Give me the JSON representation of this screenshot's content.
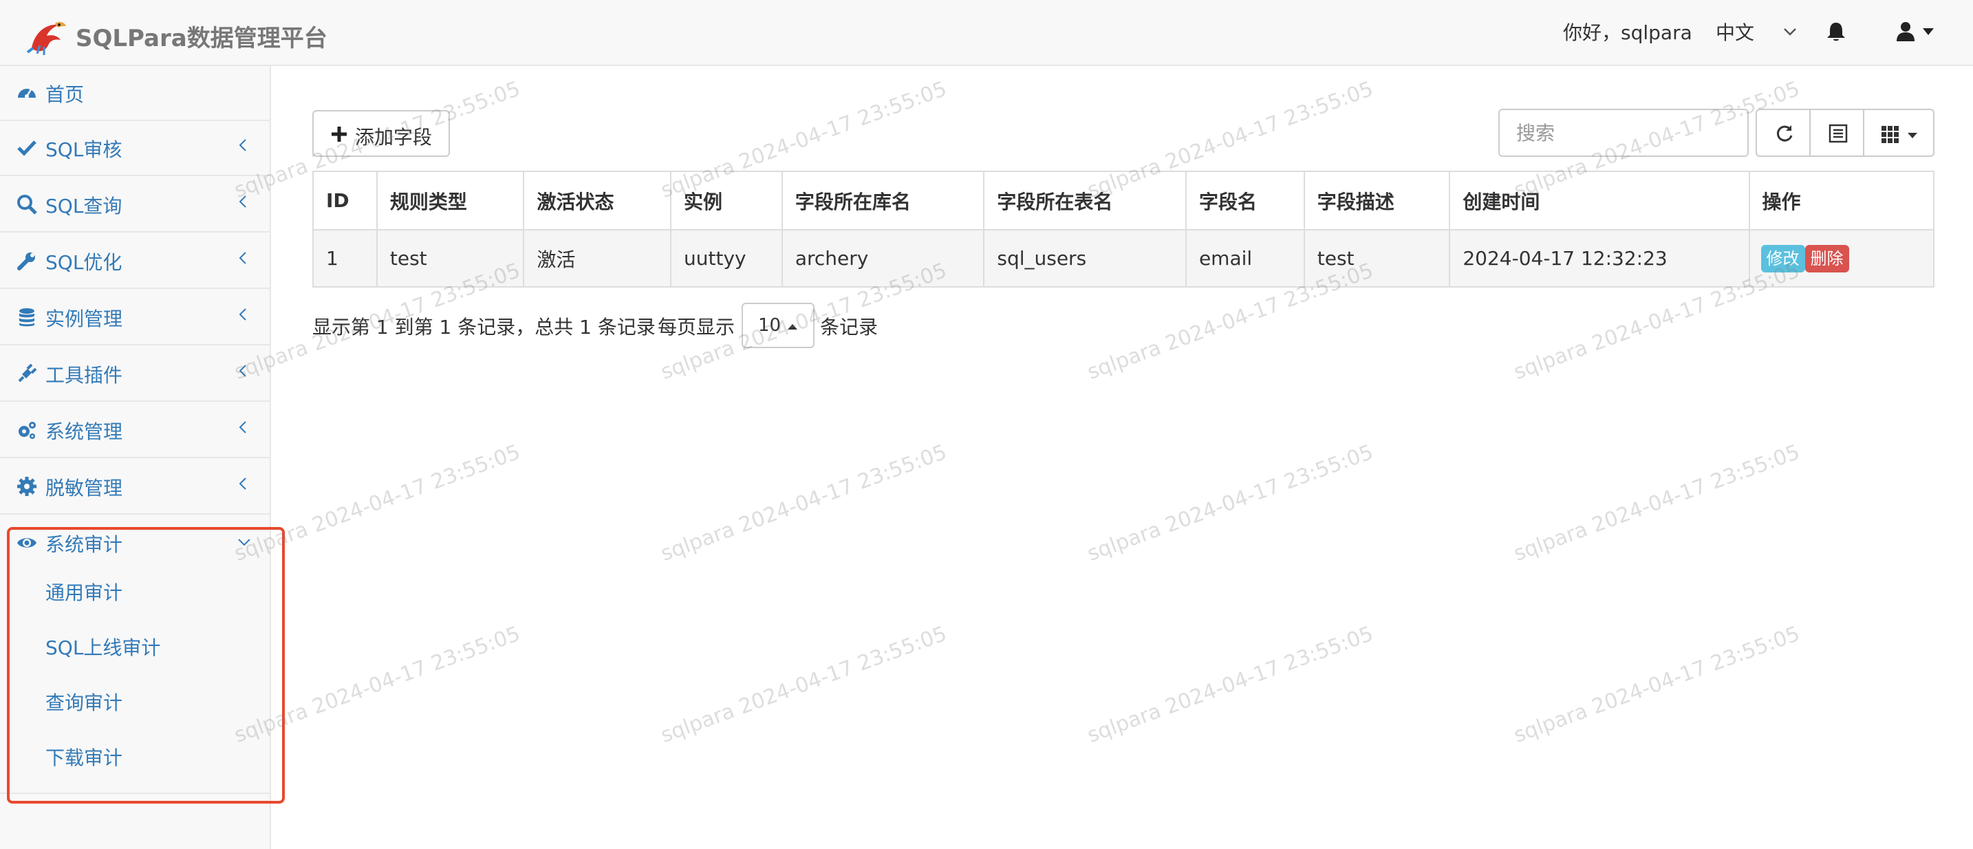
{
  "header": {
    "brand": "SQLPara数据管理平台",
    "greeting": "你好，sqlpara",
    "language": "中文"
  },
  "sidebar": {
    "items": [
      {
        "label": "首页",
        "icon": "dashboard-icon"
      },
      {
        "label": "SQL审核",
        "icon": "check-icon"
      },
      {
        "label": "SQL查询",
        "icon": "search-icon"
      },
      {
        "label": "SQL优化",
        "icon": "wrench-icon"
      },
      {
        "label": "实例管理",
        "icon": "database-icon"
      },
      {
        "label": "工具插件",
        "icon": "plug-icon"
      },
      {
        "label": "系统管理",
        "icon": "cogs-icon"
      },
      {
        "label": "脱敏管理",
        "icon": "cog-icon"
      },
      {
        "label": "系统审计",
        "icon": "eye-icon"
      }
    ],
    "submenu": [
      "通用审计",
      "SQL上线审计",
      "查询审计",
      "下载审计"
    ]
  },
  "toolbar": {
    "add_label": "添加字段",
    "search_placeholder": "搜索"
  },
  "table": {
    "columns": [
      "ID",
      "规则类型",
      "激活状态",
      "实例",
      "字段所在库名",
      "字段所在表名",
      "字段名",
      "字段描述",
      "创建时间",
      "操作"
    ],
    "rows": [
      {
        "id": "1",
        "rule_type": "test",
        "status": "激活",
        "instance": "uuttyy",
        "db": "archery",
        "table": "sql_users",
        "field": "email",
        "desc": "test",
        "created": "2024-04-17 12:32:23",
        "edit": "修改",
        "delete": "删除"
      }
    ]
  },
  "pager": {
    "summary": "显示第 1 到第 1 条记录，总共 1 条记录",
    "per_page_prefix": "每页显示",
    "page_size": "10",
    "per_page_suffix": "条记录"
  },
  "watermark": "sqlpara 2024-04-17 23:55:05",
  "colors": {
    "link": "#337ab7",
    "highlight": "#e8492f",
    "edit": "#5bc0de",
    "delete": "#d9534f"
  }
}
